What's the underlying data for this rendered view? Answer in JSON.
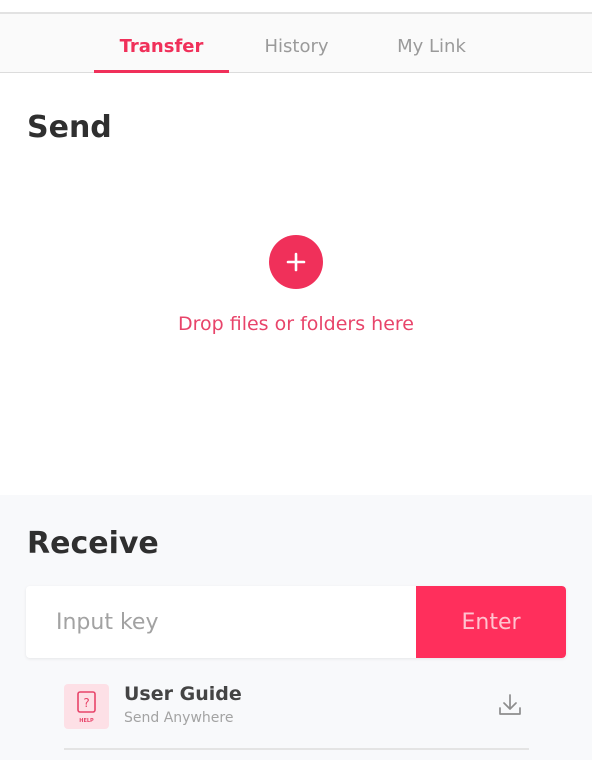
{
  "tabs": {
    "transfer": "Transfer",
    "history": "History",
    "my_link": "My Link",
    "active": "transfer"
  },
  "send": {
    "title": "Send",
    "add_icon": "plus-icon",
    "drop_label": "Drop files or folders here"
  },
  "receive": {
    "title": "Receive",
    "key_placeholder": "Input key",
    "key_value": "",
    "enter_label": "Enter"
  },
  "user_guide": {
    "title": "User Guide",
    "subtitle": "Send Anywhere",
    "icon": "help-document-icon",
    "icon_text": "HELP",
    "action_icon": "download-icon"
  },
  "colors": {
    "accent": "#f0305a",
    "enter_button": "#ff2f5c",
    "drop_text": "#e8446a",
    "receive_background": "#f8f9fb"
  }
}
